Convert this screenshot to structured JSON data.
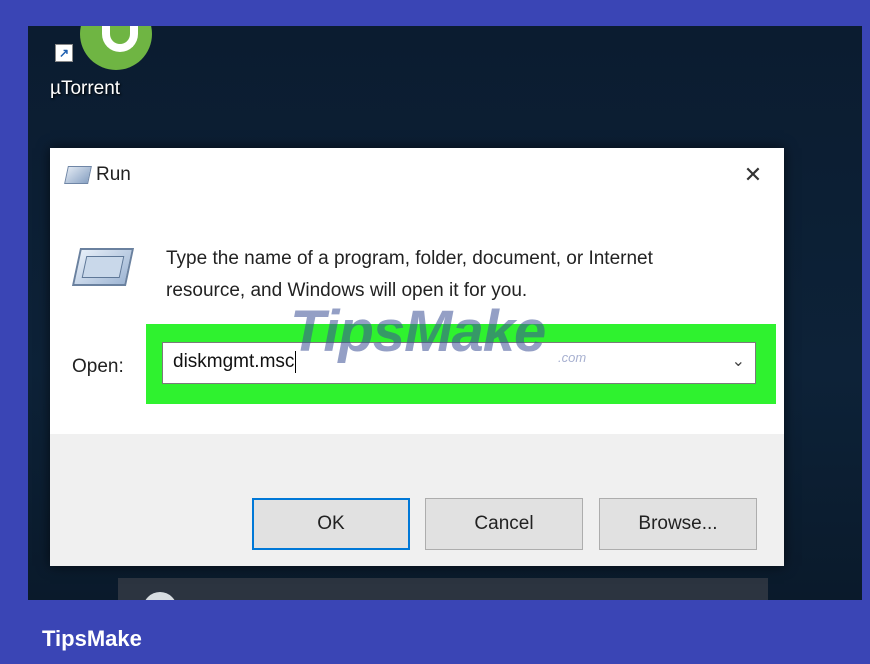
{
  "desktop": {
    "icon_label": "µTorrent"
  },
  "dialog": {
    "title": "Run",
    "close_glyph": "✕",
    "description": "Type the name of a program, folder, document, or Internet resource, and Windows will open it for you.",
    "open_label": "Open:",
    "open_value": "diskmgmt.msc",
    "dropdown_glyph": "⌄",
    "buttons": {
      "ok": "OK",
      "cancel": "Cancel",
      "browse": "Browse..."
    }
  },
  "watermark": {
    "main": "TipsMake",
    "suffix": ".com"
  },
  "brand": {
    "name": "TipsMake"
  },
  "colors": {
    "background": "#3a45b5",
    "highlight": "#2ff22f",
    "accent_focus": "#0078d7"
  }
}
